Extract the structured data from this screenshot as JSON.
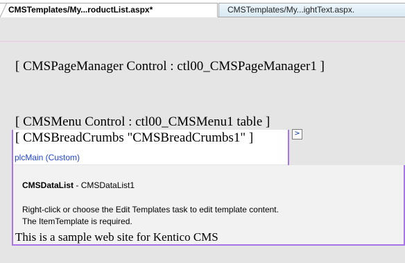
{
  "tabs": [
    {
      "label": "CMSTemplates/My...roductList.aspx*",
      "active": true
    },
    {
      "label": "CMSTemplates/My...ightText.aspx.",
      "active": false
    }
  ],
  "controls": {
    "page_manager": "[ CMSPageManager Control : ctl00_CMSPageManager1 ]",
    "menu": "[ CMSMenu Control : ctl00_CMSMenu1  table ]",
    "breadcrumbs": "[ CMSBreadCrumbs \"CMSBreadCrumbs1\" ]",
    "smart_tag_glyph": ">"
  },
  "placeholder": {
    "label": "plcMain (Custom)"
  },
  "datalist": {
    "type_name": "CMSDataList",
    "separator": " - ",
    "instance_name": "CMSDataList1",
    "description_line1": "Right-click or choose the Edit Templates task to edit template content.",
    "description_line2": "The ItemTemplate is required."
  },
  "content": {
    "sample_text": "This is a sample web site for Kentico CMS"
  },
  "colors": {
    "accent_border": "#a974e8",
    "placeholder_text": "#2244cc",
    "surface": "#e5e5e5"
  }
}
